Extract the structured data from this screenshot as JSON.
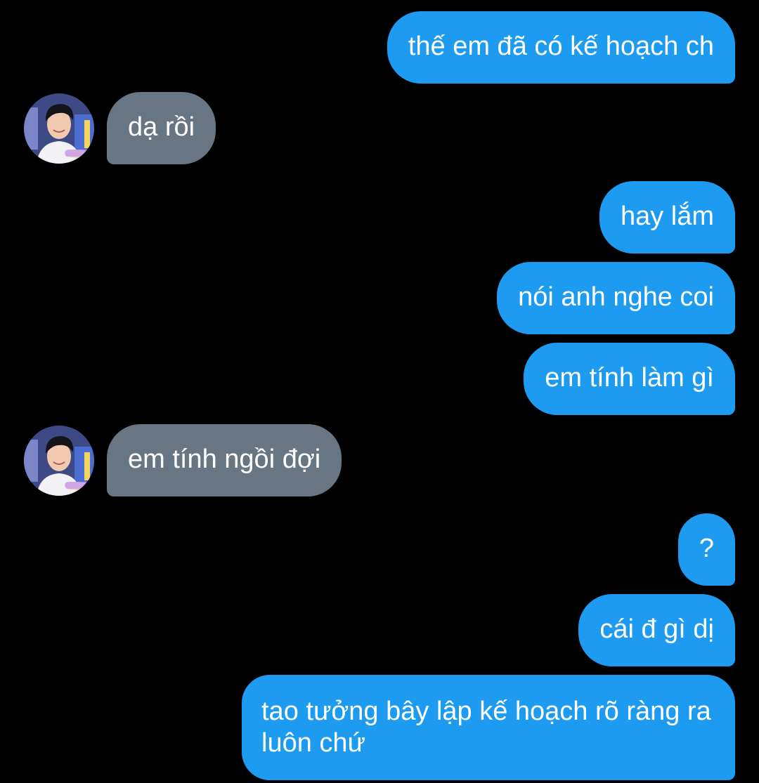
{
  "messages": [
    {
      "sender": "me",
      "text": "thế em đã có kế hoạch ch"
    },
    {
      "sender": "contact",
      "text": "dạ rồi"
    },
    {
      "sender": "me",
      "text": "hay lắm"
    },
    {
      "sender": "me",
      "text": "nói anh nghe coi"
    },
    {
      "sender": "me",
      "text": "em tính làm gì"
    },
    {
      "sender": "contact",
      "text": "em tính ngồi đợi"
    },
    {
      "sender": "me",
      "text": "?"
    },
    {
      "sender": "me",
      "text": "cái đ gì dị"
    },
    {
      "sender": "me",
      "text": "tao tưởng bây lập kế hoạch rõ ràng ra luôn chứ"
    }
  ],
  "colors": {
    "background": "#000000",
    "outgoing_bubble": "#1d9bf0",
    "incoming_bubble": "#687683",
    "text": "#ffffff"
  },
  "icons": {
    "contact_avatar": "avatar-photo"
  }
}
